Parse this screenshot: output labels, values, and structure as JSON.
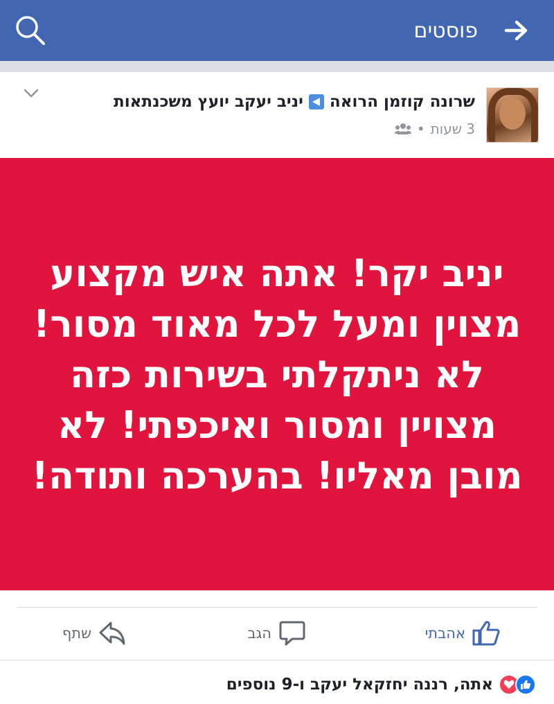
{
  "topbar": {
    "title": "פוסטים",
    "back_icon": "arrow-right-icon",
    "search_icon": "search-icon",
    "color": "#4267b2"
  },
  "post": {
    "author": "שרונה קוזמן הרואה",
    "recipient": "יניב יעקב יועץ משכנתאות",
    "time": "3 שעות",
    "privacy_icon": "friends-icon",
    "text": "יניב יקר! אתה איש מקצוע מצוין ומעל לכל מאוד מסור! לא ניתקלתי בשירות כזה מצויין ומסור ואיכפתי! לא מובן מאליו! בהערכה ותודה!",
    "background_color": "#e0143c"
  },
  "actions": {
    "like_label": "אהבתי",
    "comment_label": "הגב",
    "share_label": "שתף"
  },
  "reactions": {
    "summary": "אתה, רננה יחזקאל יעקב ו-9 נוספים",
    "icons": [
      "like-reaction-icon",
      "love-reaction-icon"
    ]
  }
}
